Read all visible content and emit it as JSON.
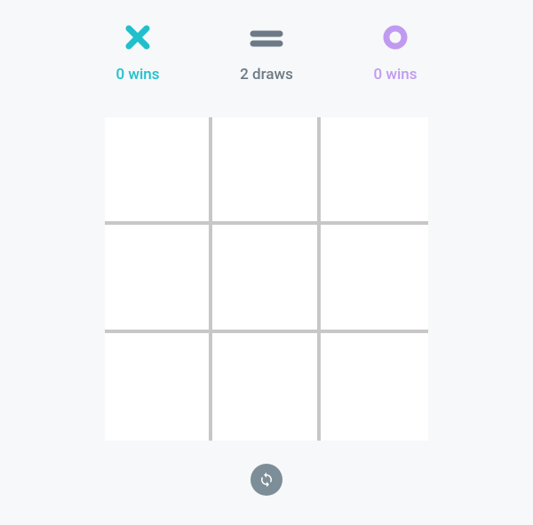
{
  "colors": {
    "x": "#1fc0cc",
    "draw": "#6d7a85",
    "o": "#c09af0",
    "board_line": "#c7c7c7",
    "cell_bg": "#ffffff",
    "page_bg": "#f6f8f9",
    "reset_bg": "#7d8e98"
  },
  "score": {
    "x": {
      "icon_name": "x-mark-icon",
      "wins": 0,
      "label": "0 wins"
    },
    "draw": {
      "icon_name": "draw-icon",
      "count": 2,
      "label": "2 draws"
    },
    "o": {
      "icon_name": "o-mark-icon",
      "wins": 0,
      "label": "0 wins"
    }
  },
  "board": {
    "cells": [
      "",
      "",
      "",
      "",
      "",
      "",
      "",
      "",
      ""
    ]
  },
  "controls": {
    "reset_icon_name": "reset-icon"
  }
}
